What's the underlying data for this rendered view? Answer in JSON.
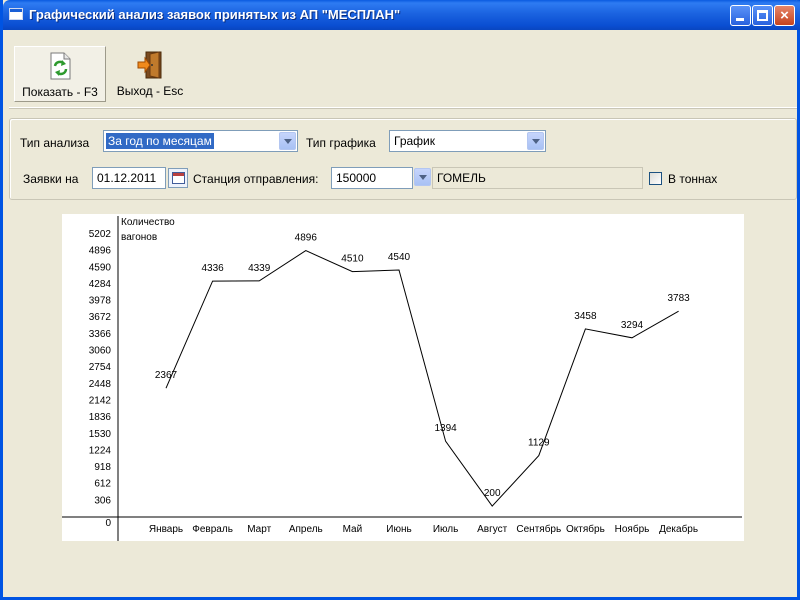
{
  "window": {
    "title": "Графический анализ заявок принятых из АП \"МЕСПЛАН\"",
    "controls": {
      "minimize": "minimize",
      "maximize": "maximize",
      "close": "×"
    }
  },
  "toolbar": {
    "show_label": "Показать - F3",
    "exit_label": "Выход - Esc",
    "show_icon": "refresh-document-icon",
    "exit_icon": "exit-door-icon"
  },
  "params": {
    "analysis_type_label": "Тип анализа",
    "analysis_type_value": "За год по месяцам",
    "chart_type_label": "Тип графика",
    "chart_type_value": "График",
    "requests_on_label": "Заявки на",
    "date_value": "01.12.2011",
    "station_label": "Станция отправления:",
    "station_code": "150000",
    "station_name": "ГОМЕЛЬ",
    "in_tons_label": "В тоннах",
    "in_tons_checked": false
  },
  "colors": {
    "title_bar": "#0A4ED2",
    "selection": "#316AC5",
    "window_bg": "#ECE9D8"
  },
  "chart_data": {
    "type": "line",
    "ylabel_line1": "Количество",
    "ylabel_line2": "вагонов",
    "yticks": [
      "0",
      "306",
      "612",
      "918",
      "1224",
      "1530",
      "1836",
      "2142",
      "2448",
      "2754",
      "3060",
      "3366",
      "3672",
      "3978",
      "4284",
      "4590",
      "4896",
      "5202"
    ],
    "ylim": [
      0,
      5202
    ],
    "categories": [
      "Январь",
      "Февраль",
      "Март",
      "Апрель",
      "Май",
      "Июнь",
      "Июль",
      "Август",
      "Сентябрь",
      "Октябрь",
      "Ноябрь",
      "Декабрь"
    ],
    "series": [
      {
        "values": [
          2367,
          4336,
          4339,
          4896,
          4510,
          4540,
          1394,
          200,
          1129,
          3458,
          3294,
          3783
        ]
      }
    ],
    "data_labels": [
      "2367",
      "4336",
      "4339",
      "4896",
      "4510",
      "4540",
      "1394",
      "200",
      "1129",
      "3458",
      "3294",
      "3783"
    ],
    "grid": false
  }
}
